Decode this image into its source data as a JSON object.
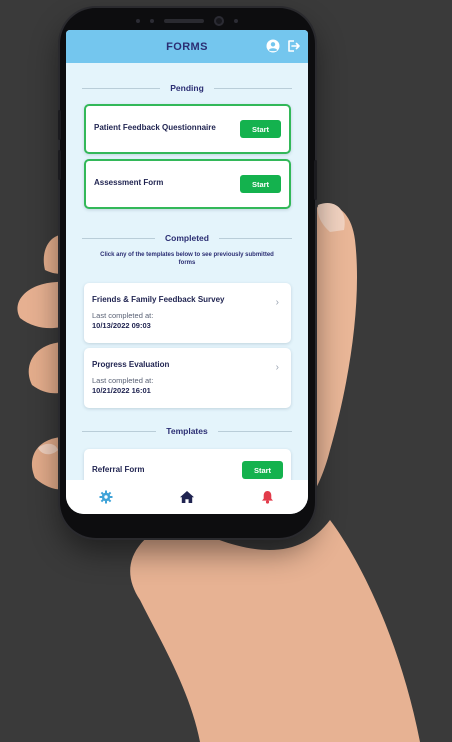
{
  "header": {
    "title": "FORMS"
  },
  "pending": {
    "section_label": "Pending",
    "items": [
      {
        "title": "Patient Feedback Questionnaire",
        "action_label": "Start"
      },
      {
        "title": "Assessment Form",
        "action_label": "Start"
      }
    ]
  },
  "completed": {
    "section_label": "Completed",
    "hint": "Click any of the templates below to see previously submitted forms",
    "items": [
      {
        "title": "Friends & Family Feedback Survey",
        "last_label": "Last completed at:",
        "date": "10/13/2022 09:03"
      },
      {
        "title": "Progress Evaluation",
        "last_label": "Last completed at:",
        "date": "10/21/2022 16:01"
      }
    ]
  },
  "templates": {
    "section_label": "Templates",
    "items": [
      {
        "title": "Referral Form",
        "action_label": "Start"
      }
    ]
  },
  "bottom_nav": {
    "items": [
      {
        "icon": "gear-icon"
      },
      {
        "icon": "home-icon"
      },
      {
        "icon": "bell-icon"
      }
    ]
  },
  "colors": {
    "header_bg": "#74c6ee",
    "screen_bg": "#e4f4fb",
    "title_text": "#2b2e73",
    "accent_green": "#14b24e",
    "gear": "#3fa3d8",
    "home": "#1f2350",
    "bell": "#e23b4a"
  }
}
